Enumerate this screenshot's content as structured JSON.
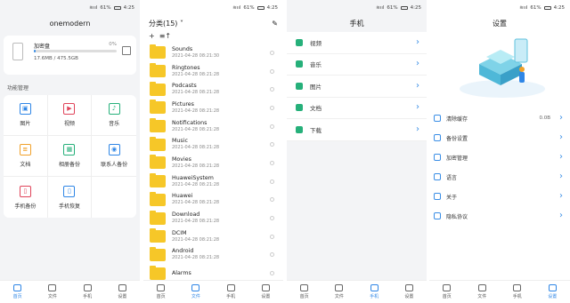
{
  "status": {
    "signal": "≋ııl",
    "battery_pct": "61%",
    "time": "4:25",
    "time2": "4:25"
  },
  "home": {
    "title": "onemodern",
    "storage": {
      "name": "加密盘",
      "percent": "0%",
      "usage": "17.6MB / 475.5GB",
      "fill": 0.02
    },
    "section_title": "功能管理",
    "features": [
      {
        "label": "图片",
        "icon": "image-icon",
        "color": "#2f86e6",
        "glyph": "▣"
      },
      {
        "label": "视频",
        "icon": "video-icon",
        "color": "#e0445a",
        "glyph": "▶"
      },
      {
        "label": "音乐",
        "icon": "music-icon",
        "color": "#26b07a",
        "glyph": "♪"
      },
      {
        "label": "文档",
        "icon": "document-icon",
        "color": "#f0a12a",
        "glyph": "≡"
      },
      {
        "label": "相册备份",
        "icon": "album-backup-icon",
        "color": "#26b07a",
        "glyph": "▦"
      },
      {
        "label": "联系人备份",
        "icon": "contacts-backup-icon",
        "color": "#2f86e6",
        "glyph": "◉"
      },
      {
        "label": "手机备份",
        "icon": "phone-backup-icon",
        "color": "#e0445a",
        "glyph": "▯"
      },
      {
        "label": "手机恢复",
        "icon": "phone-restore-icon",
        "color": "#2f86e6",
        "glyph": "▯"
      }
    ]
  },
  "files": {
    "title": "分类(15)",
    "toolbar": {
      "add": "+",
      "sort": "≡↑"
    },
    "folders": [
      {
        "name": "Sounds",
        "date": "2021-04-28 08:21:30"
      },
      {
        "name": "Ringtones",
        "date": "2021-04-28 08:21:28"
      },
      {
        "name": "Podcasts",
        "date": "2021-04-28 08:21:28"
      },
      {
        "name": "Pictures",
        "date": "2021-04-28 08:21:28"
      },
      {
        "name": "Notifications",
        "date": "2021-04-28 08:21:28"
      },
      {
        "name": "Music",
        "date": "2021-04-28 08:21:28"
      },
      {
        "name": "Movies",
        "date": "2021-04-28 08:21:28"
      },
      {
        "name": "HuaweiSystem",
        "date": "2021-04-28 08:21:28"
      },
      {
        "name": "Huawei",
        "date": "2021-04-28 08:21:28"
      },
      {
        "name": "Download",
        "date": "2021-04-28 08:21:28"
      },
      {
        "name": "DCIM",
        "date": "2021-04-28 08:21:28"
      },
      {
        "name": "Android",
        "date": "2021-04-28 08:21:28"
      },
      {
        "name": "Alarms",
        "date": ""
      }
    ]
  },
  "phone": {
    "title": "手机",
    "items": [
      {
        "label": "视频",
        "icon": "video-icon"
      },
      {
        "label": "音乐",
        "icon": "music-icon"
      },
      {
        "label": "图片",
        "icon": "image-icon"
      },
      {
        "label": "文档",
        "icon": "document-icon"
      },
      {
        "label": "下载",
        "icon": "download-icon"
      }
    ]
  },
  "settings": {
    "title": "设置",
    "items": [
      {
        "label": "清除缓存",
        "value": "0.0B",
        "icon": "clear-cache-icon"
      },
      {
        "label": "备份设置",
        "value": "",
        "icon": "backup-settings-icon"
      },
      {
        "label": "加密管理",
        "value": "",
        "icon": "encryption-icon"
      },
      {
        "label": "语言",
        "value": "",
        "icon": "language-icon"
      },
      {
        "label": "关于",
        "value": "",
        "icon": "about-icon"
      },
      {
        "label": "隐私协议",
        "value": "",
        "icon": "privacy-icon"
      }
    ]
  },
  "nav": [
    "首页",
    "文件",
    "手机",
    "设置"
  ],
  "active_tabs": [
    0,
    1,
    2,
    3
  ],
  "chevron": "›",
  "accent": "#2f86e6"
}
